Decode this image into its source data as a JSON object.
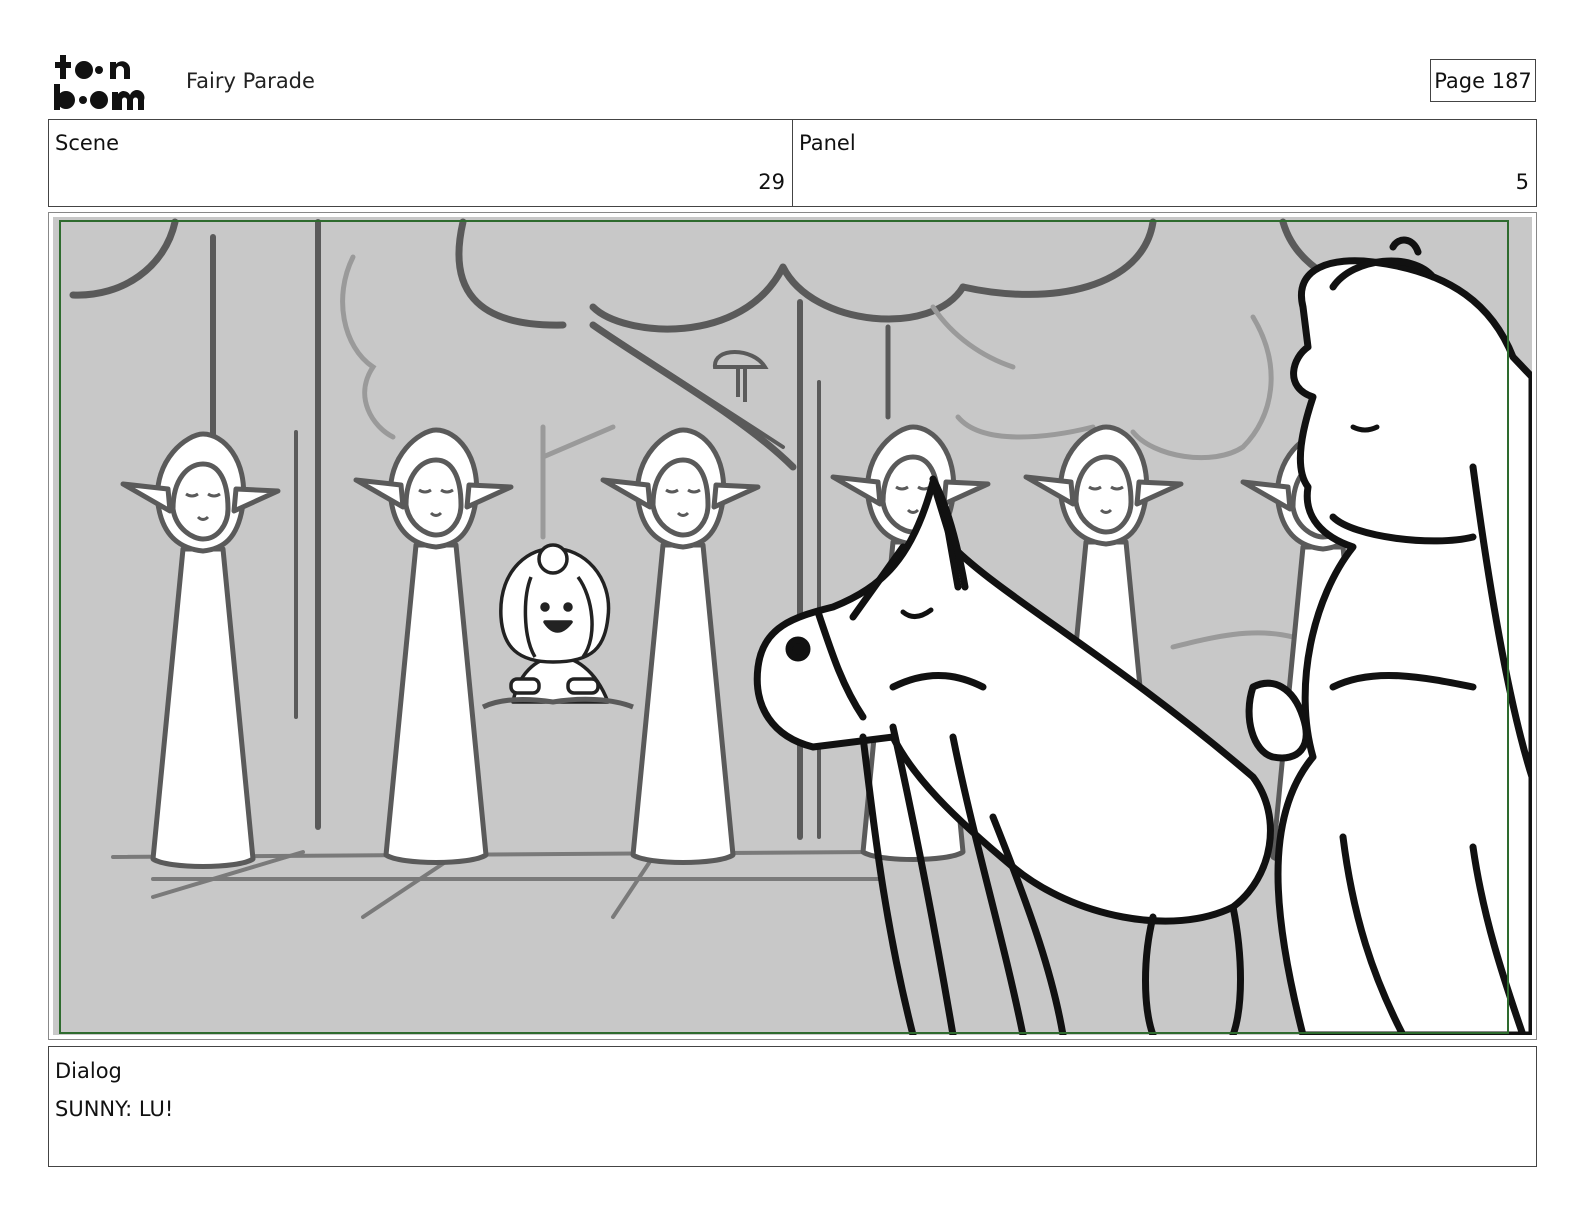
{
  "header": {
    "logo_text_top": "toon",
    "logo_text_bottom": "boom",
    "project_title": "Fairy Parade",
    "page_label": "Page 187"
  },
  "info": {
    "scene_label": "Scene",
    "scene_value": "29",
    "panel_label": "Panel",
    "panel_value": "5"
  },
  "frame": {
    "background_color": "#c8c8c8",
    "border_color": "#2e6b2e",
    "sketch_gray": "#5a5a5a",
    "sketch_black": "#111111"
  },
  "dialog": {
    "label": "Dialog",
    "text": "SUNNY: LU!"
  }
}
